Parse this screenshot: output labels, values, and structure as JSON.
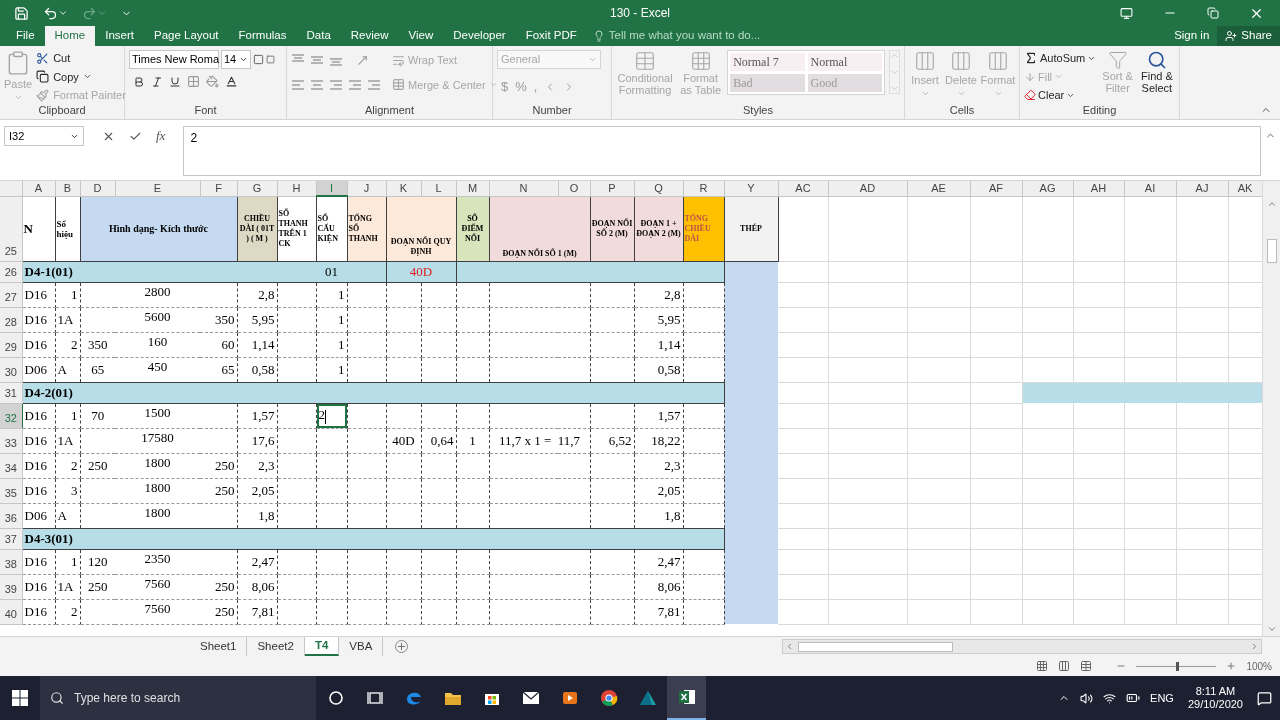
{
  "window": {
    "title": "130 - Excel"
  },
  "menu_tabs": [
    {
      "label": "File",
      "selected": false
    },
    {
      "label": "Home",
      "selected": true
    },
    {
      "label": "Insert",
      "selected": false
    },
    {
      "label": "Page Layout",
      "selected": false
    },
    {
      "label": "Formulas",
      "selected": false
    },
    {
      "label": "Data",
      "selected": false
    },
    {
      "label": "Review",
      "selected": false
    },
    {
      "label": "View",
      "selected": false
    },
    {
      "label": "Developer",
      "selected": false
    },
    {
      "label": "Foxit PDF",
      "selected": false
    }
  ],
  "tell_me": {
    "placeholder": "Tell me what you want to do..."
  },
  "account": {
    "sign_in": "Sign in",
    "share": "Share"
  },
  "ribbon": {
    "clipboard": {
      "label": "Clipboard",
      "paste": {
        "text": "Paste",
        "disabled": true
      },
      "cut": {
        "text": "Cut",
        "disabled": false
      },
      "copy": {
        "text": "Copy",
        "disabled": false
      },
      "format_painter": {
        "text": "Format Painter",
        "disabled": true
      }
    },
    "font": {
      "label": "Font",
      "name": "Times New Roma",
      "size": "14"
    },
    "alignment": {
      "label": "Alignment",
      "wrap": {
        "text": "Wrap Text",
        "disabled": true
      },
      "merge": {
        "text": "Merge & Center",
        "disabled": true
      }
    },
    "number": {
      "label": "Number",
      "format": {
        "text": "General",
        "disabled": true
      },
      "symbols": [
        "$",
        "%",
        ","
      ]
    },
    "styles": {
      "label": "Styles",
      "conditional": {
        "text": "Conditional Formatting",
        "disabled": true
      },
      "format_table": {
        "text": "Format as Table",
        "disabled": true
      },
      "gallery": [
        {
          "text": "Normal 7",
          "kind": "normal"
        },
        {
          "text": "Normal",
          "kind": "normal"
        },
        {
          "text": "Bad",
          "kind": "bad"
        },
        {
          "text": "Good",
          "kind": "good"
        }
      ]
    },
    "cells": {
      "label": "Cells",
      "buttons": [
        {
          "text": "Insert",
          "disabled": true
        },
        {
          "text": "Delete",
          "disabled": true
        },
        {
          "text": "Format",
          "disabled": true
        }
      ]
    },
    "editing": {
      "label": "Editing",
      "autosum": {
        "text": "AutoSum",
        "disabled": false
      },
      "fill": {
        "text": "Fill",
        "disabled": true
      },
      "clear": {
        "text": "Clear",
        "disabled": false
      },
      "sort": {
        "text": "Sort & Filter",
        "disabled": true
      },
      "find": {
        "text": "Find & Select",
        "disabled": false
      }
    }
  },
  "formula_bar": {
    "name_box": "I32",
    "function_label": "fx",
    "value": "2"
  },
  "columns": [
    {
      "letter": "A",
      "selected": false
    },
    {
      "letter": "B",
      "selected": false
    },
    {
      "letter": "D",
      "selected": false
    },
    {
      "letter": "E",
      "selected": false
    },
    {
      "letter": "F",
      "selected": false
    },
    {
      "letter": "G",
      "selected": false
    },
    {
      "letter": "H",
      "selected": false
    },
    {
      "letter": "I",
      "selected": true
    },
    {
      "letter": "J",
      "selected": false
    },
    {
      "letter": "K",
      "selected": false
    },
    {
      "letter": "L",
      "selected": false
    },
    {
      "letter": "M",
      "selected": false
    },
    {
      "letter": "N",
      "selected": false
    },
    {
      "letter": "O",
      "selected": false
    },
    {
      "letter": "P",
      "selected": false
    },
    {
      "letter": "Q",
      "selected": false
    },
    {
      "letter": "R",
      "selected": false
    },
    {
      "letter": "Y",
      "selected": false
    },
    {
      "letter": "AC",
      "selected": false
    },
    {
      "letter": "AD",
      "selected": false
    },
    {
      "letter": "AE",
      "selected": false
    },
    {
      "letter": "AF",
      "selected": false
    },
    {
      "letter": "AG",
      "selected": false
    },
    {
      "letter": "AH",
      "selected": false
    },
    {
      "letter": "AI",
      "selected": false
    },
    {
      "letter": "AJ",
      "selected": false
    },
    {
      "letter": "AK",
      "selected": false
    }
  ],
  "rows": [
    {
      "kind": "header",
      "number": "25",
      "selected": false,
      "cells": [
        {
          "text": "N",
          "color": "#ffffff"
        },
        {
          "text": "Số hiệu",
          "color": "#ffffff"
        },
        {
          "text": "Hình dạng- Kích thước",
          "color": "#c5d9f1"
        },
        {
          "text": "CHIỀU DÀI ( 01T ) ( M )",
          "color": "#ddd9c4"
        },
        {
          "text": "SỐ THANH TRÊN 1 CK",
          "color": "#ffffff"
        },
        {
          "text": "SỐ CẤU KIỆN",
          "color": "#ffffff"
        },
        {
          "text": "TỔNG SỐ THANH",
          "color": "#fde9d9"
        },
        {
          "text": "ĐOẠN NỐI QUY ĐỊNH",
          "color": "#fde9d9"
        },
        {
          "text": "SỐ ĐIỂM NỐI",
          "color": "#d8e4bc"
        },
        {
          "text": "ĐOẠN NỐI SỐ 1 (M)",
          "color": "#f2dcdb"
        },
        {
          "text": "ĐOẠN NỐI SỐ 2 (M)",
          "color": "#f2dcdb"
        },
        {
          "text": "ĐOẠN 1 + ĐOẠN 2 (M)",
          "color": "#f2dcdb"
        },
        {
          "text": "TỔNG CHIỀU DÀI",
          "color": "#ffc000"
        },
        {
          "text": "THÉP",
          "color": "#f2f2f2"
        }
      ]
    },
    {
      "kind": "section",
      "number": "26",
      "selected": false,
      "title": "D4-1(01)",
      "count": "01",
      "splice": "40D",
      "highlight_right": false
    },
    {
      "kind": "data",
      "number": "27",
      "selected": false,
      "cells": [
        "D16",
        {
          "text": "1",
          "kind": "number"
        },
        null,
        "2800",
        null,
        "2,8",
        null,
        "1",
        null,
        null,
        null,
        null,
        null,
        null,
        "2,8",
        null
      ]
    },
    {
      "kind": "data",
      "number": "28",
      "selected": false,
      "cells": [
        "D16",
        {
          "text": "1A",
          "kind": "text"
        },
        null,
        "5600",
        "350",
        "5,95",
        null,
        "1",
        null,
        null,
        null,
        null,
        null,
        null,
        "5,95",
        null
      ]
    },
    {
      "kind": "data",
      "number": "29",
      "selected": false,
      "cells": [
        "D16",
        {
          "text": "2",
          "kind": "number"
        },
        "350",
        "160",
        "60",
        "1,14",
        null,
        "1",
        null,
        null,
        null,
        null,
        null,
        null,
        "1,14",
        null
      ]
    },
    {
      "kind": "data",
      "number": "30",
      "selected": false,
      "cells": [
        "D06",
        {
          "text": "A",
          "kind": "text"
        },
        "65",
        "450",
        "65",
        "0,58",
        null,
        "1",
        null,
        null,
        null,
        null,
        null,
        null,
        "0,58",
        null
      ]
    },
    {
      "kind": "section",
      "number": "31",
      "selected": false,
      "title": "D4-2(01)",
      "highlight_right": true
    },
    {
      "kind": "data",
      "number": "32",
      "selected": true,
      "cells": [
        "D16",
        {
          "text": "1",
          "kind": "number"
        },
        "70",
        "1500",
        null,
        "1,57",
        null,
        "2",
        null,
        null,
        null,
        null,
        null,
        null,
        "1,57",
        null
      ]
    },
    {
      "kind": "data",
      "number": "33",
      "selected": false,
      "cells": [
        "D16",
        {
          "text": "1A",
          "kind": "text"
        },
        null,
        "17580",
        null,
        "17,6",
        null,
        null,
        null,
        "40D",
        "0,64",
        "1",
        "11,7 x 1 =  11,7",
        "6,52",
        "18,22",
        null
      ]
    },
    {
      "kind": "data",
      "number": "34",
      "selected": false,
      "cells": [
        "D16",
        {
          "text": "2",
          "kind": "number"
        },
        "250",
        "1800",
        "250",
        "2,3",
        null,
        null,
        null,
        null,
        null,
        null,
        null,
        null,
        "2,3",
        null
      ]
    },
    {
      "kind": "data",
      "number": "35",
      "selected": false,
      "cells": [
        "D16",
        {
          "text": "3",
          "kind": "number"
        },
        null,
        "1800",
        "250",
        "2,05",
        null,
        null,
        null,
        null,
        null,
        null,
        null,
        null,
        "2,05",
        null
      ]
    },
    {
      "kind": "data",
      "number": "36",
      "selected": false,
      "cells": [
        "D06",
        {
          "text": "A",
          "kind": "text"
        },
        null,
        "1800",
        null,
        "1,8",
        null,
        null,
        null,
        null,
        null,
        null,
        null,
        null,
        "1,8",
        null
      ]
    },
    {
      "kind": "section",
      "number": "37",
      "selected": false,
      "title": "D4-3(01)",
      "highlight_right": false
    },
    {
      "kind": "data",
      "number": "38",
      "selected": false,
      "cells": [
        "D16",
        {
          "text": "1",
          "kind": "number"
        },
        "120",
        "2350",
        null,
        "2,47",
        null,
        null,
        null,
        null,
        null,
        null,
        null,
        null,
        "2,47",
        null
      ]
    },
    {
      "kind": "data",
      "number": "39",
      "selected": false,
      "cells": [
        "D16",
        {
          "text": "1A",
          "kind": "text"
        },
        "250",
        "7560",
        "250",
        "8,06",
        null,
        null,
        null,
        null,
        null,
        null,
        null,
        null,
        "8,06",
        null
      ]
    },
    {
      "kind": "data",
      "number": "40",
      "selected": false,
      "cells": [
        "D16",
        {
          "text": "2",
          "kind": "number"
        },
        null,
        "7560",
        "250",
        "7,81",
        null,
        null,
        null,
        null,
        null,
        null,
        null,
        null,
        "7,81",
        null
      ]
    }
  ],
  "sheet_tabs": [
    {
      "label": "Sheet1",
      "selected": false
    },
    {
      "label": "Sheet2",
      "selected": false
    },
    {
      "label": "T4",
      "selected": true
    },
    {
      "label": "VBA",
      "selected": false
    }
  ],
  "status_bar": {
    "zoom": {
      "label": "100%",
      "level": 0.5
    }
  },
  "taskbar": {
    "search": {
      "placeholder": "Type here to search"
    },
    "apps": [
      {
        "kind": "cortana",
        "active": false
      },
      {
        "kind": "taskview",
        "active": false
      },
      {
        "kind": "edge",
        "active": false
      },
      {
        "kind": "explorer",
        "active": false
      },
      {
        "kind": "store",
        "active": false
      },
      {
        "kind": "mail",
        "active": false
      },
      {
        "kind": "media",
        "active": false
      },
      {
        "kind": "chrome",
        "active": false
      },
      {
        "kind": "autodesk",
        "active": false
      },
      {
        "kind": "excel",
        "active": true
      }
    ],
    "language": "ENG",
    "time": "8:11 AM",
    "date": "29/10/2020"
  }
}
